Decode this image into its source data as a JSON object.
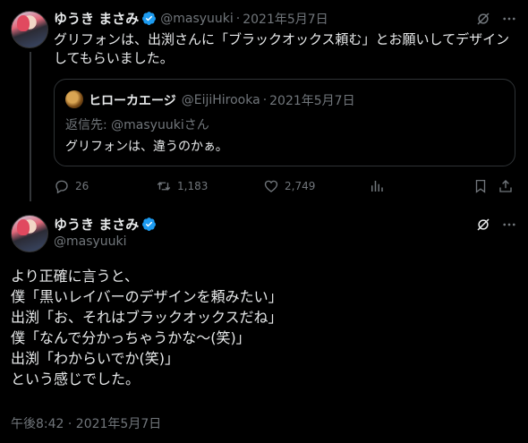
{
  "reply_tweet": {
    "display_name": "ゆうき まさみ",
    "handle": "@masyuuki",
    "separator": "·",
    "date": "2021年5月7日",
    "text_lines": [
      "グリフォンは、出渕さんに「ブラックオックス頼む」とお願いしてデザイン",
      "してもらいました。"
    ],
    "quoted": {
      "display_name": "ヒローカエージ",
      "handle": "@EijiHirooka",
      "separator": "·",
      "date": "2021年5月7日",
      "reply_to": "返信先: @masyuukiさん",
      "text": "グリフォンは、違うのかぁ。"
    },
    "actions": {
      "replies": "26",
      "retweets": "1,183",
      "likes": "2,749"
    }
  },
  "main_tweet": {
    "display_name": "ゆうき まさみ",
    "handle": "@masyuuki",
    "text_lines": [
      "より正確に言うと、",
      "僕「黒いレイバーのデザインを頼みたい」",
      "出渕「お、それはブラックオックスだね」",
      "僕「なんで分かっちゃうかな〜(笑)」",
      "出渕「わからいでか(笑)」",
      "という感じでした。"
    ],
    "timestamp": "午後8:42 · 2021年5月7日"
  },
  "colors": {
    "background": "#000000",
    "text": "#e7e9ea",
    "muted": "#71767b",
    "verified": "#1d9bf0",
    "border": "#2f3336"
  }
}
